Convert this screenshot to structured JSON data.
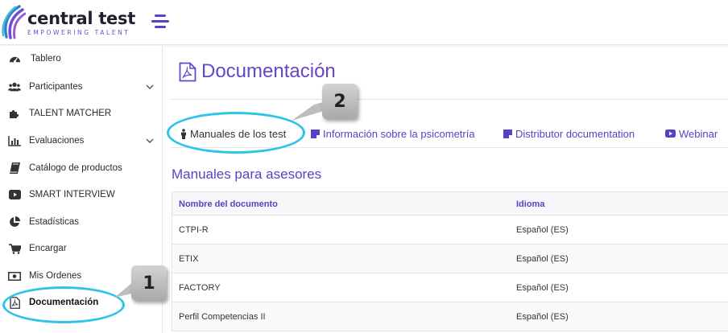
{
  "header": {
    "brand_name": "central test",
    "brand_tagline": "EMPOWERING TALENT"
  },
  "sidebar": {
    "items": [
      {
        "label": "Tablero",
        "icon": "dashboard-icon"
      },
      {
        "label": "Participantes",
        "icon": "users-icon",
        "expandable": true
      },
      {
        "label": "TALENT MATCHER",
        "icon": "puzzle-icon"
      },
      {
        "label": "Evaluaciones",
        "icon": "bar-chart-icon",
        "expandable": true
      },
      {
        "label": "Catálogo de productos",
        "icon": "book-icon"
      },
      {
        "label": "SMART INTERVIEW",
        "icon": "video-icon"
      },
      {
        "label": "Estadísticas",
        "icon": "pie-chart-icon"
      },
      {
        "label": "Encargar",
        "icon": "cart-icon"
      },
      {
        "label": "Mis Ordenes",
        "icon": "money-icon"
      },
      {
        "label": "Documentación",
        "icon": "pdf-icon",
        "active": true
      }
    ]
  },
  "main": {
    "title": "Documentación",
    "tabs": [
      {
        "label": "Manuales de los test",
        "icon": "person-icon",
        "active": true
      },
      {
        "label": "Información sobre la psicometría",
        "icon": "note-icon"
      },
      {
        "label": "Distributor documentation",
        "icon": "note-icon"
      },
      {
        "label": "Webinar",
        "icon": "youtube-icon"
      }
    ],
    "section_title": "Manuales para asesores",
    "table": {
      "columns": [
        "Nombre del documento",
        "Idioma"
      ],
      "rows": [
        [
          "CTPI-R",
          "Español (ES)"
        ],
        [
          "ETIX",
          "Español (ES)"
        ],
        [
          "FACTORY",
          "Español (ES)"
        ],
        [
          "Perfil Competencias II",
          "Español (ES)"
        ]
      ]
    }
  },
  "callouts": {
    "one": "1",
    "two": "2"
  },
  "colors": {
    "accent": "#5b3fc4",
    "callout_ring": "#2ec4e8"
  }
}
